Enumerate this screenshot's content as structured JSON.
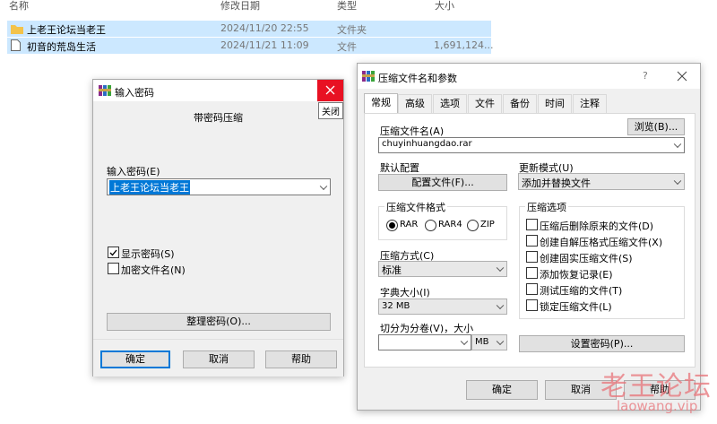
{
  "explorer": {
    "columns": [
      "名称",
      "修改日期",
      "类型",
      "大小"
    ],
    "rows": [
      {
        "name": "上老王论坛当老王",
        "date": "2024/11/20 22:55",
        "type": "文件夹",
        "size": ""
      },
      {
        "name": "初音的荒岛生活",
        "date": "2024/11/21 11:09",
        "type": "文件",
        "size": "1,691,124..."
      }
    ]
  },
  "password_dialog": {
    "title": "输入密码",
    "close_tooltip": "关闭",
    "heading": "带密码压缩",
    "password_label": "输入密码(E)",
    "password_value": "上老王论坛当老王",
    "show_password": "显示密码(S)",
    "show_password_checked": true,
    "encrypt_names": "加密文件名(N)",
    "encrypt_names_checked": false,
    "organize_button": "整理密码(O)...",
    "ok": "确定",
    "cancel": "取消",
    "help": "帮助"
  },
  "archive_dialog": {
    "title": "压缩文件名和参数",
    "help_glyph": "?",
    "tabs": [
      "常规",
      "高级",
      "选项",
      "文件",
      "备份",
      "时间",
      "注释"
    ],
    "archive_name_label": "压缩文件名(A)",
    "browse": "浏览(B)...",
    "archive_name": "chuyinhuangdao.rar",
    "default_profile_label": "默认配置",
    "profile_button": "配置文件(F)...",
    "update_mode_label": "更新模式(U)",
    "update_mode": "添加并替换文件",
    "format_label": "压缩文件格式",
    "formats": [
      "RAR",
      "RAR4",
      "ZIP"
    ],
    "format_selected": "RAR",
    "method_label": "压缩方式(C)",
    "method": "标准",
    "dict_label": "字典大小(I)",
    "dict": "32 MB",
    "split_label": "切分为分卷(V)，大小",
    "split_value": "",
    "split_unit": "MB",
    "options_label": "压缩选项",
    "options": [
      {
        "label": "压缩后删除原来的文件(D)",
        "checked": false
      },
      {
        "label": "创建自解压格式压缩文件(X)",
        "checked": false
      },
      {
        "label": "创建固实压缩文件(S)",
        "checked": false
      },
      {
        "label": "添加恢复记录(E)",
        "checked": false
      },
      {
        "label": "测试压缩的文件(T)",
        "checked": false
      },
      {
        "label": "锁定压缩文件(L)",
        "checked": false
      }
    ],
    "set_password": "设置密码(P)...",
    "ok": "确定",
    "cancel": "取消",
    "help": "帮助"
  },
  "watermark": {
    "line1": "老王论坛",
    "line2": "laowang.vip"
  },
  "colors": {
    "close_red": "#e81123",
    "selection": "#0078d7",
    "row_highlight": "#cce8ff",
    "watermark": "#e8747a"
  }
}
